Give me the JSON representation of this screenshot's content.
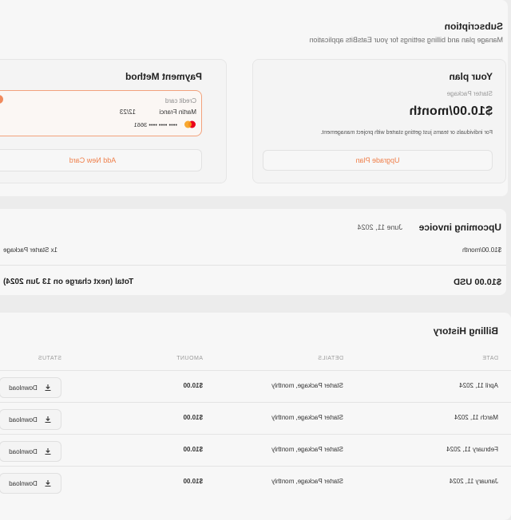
{
  "subscription": {
    "title": "Subscription",
    "subtitle": "Manage plan and billing settings for your EatsBits application"
  },
  "plan": {
    "title": "Your plan",
    "package_label": "Starter Package",
    "price": "$10.00/month",
    "description": "For individuals or teams just getting started with project management.",
    "upgrade_label": "Upgrade Plan"
  },
  "payment": {
    "title": "Payment Method",
    "card_type": "Credit card",
    "card_name": "Martin Franci",
    "card_expiry": "12/23",
    "card_number": "•••• •••• •••• 3661",
    "add_card_label": "Add New Card"
  },
  "invoice": {
    "title": "Upcoming invoice",
    "date": "June 11, 2024",
    "line_item": "1x Starter Package",
    "line_amount": "$10.00/month",
    "total_label": "Total (next charge on 13 Jun 2024)",
    "total_amount": "$10.00 USD"
  },
  "history": {
    "title": "Billing History",
    "columns": {
      "date": "DATE",
      "details": "DETAILS",
      "amount": "AMOUNT",
      "status": "STATUS"
    },
    "download_label": "Download",
    "rows": [
      {
        "date": "April 11, 2024",
        "details": "Starter Package, monthly",
        "amount": "$10.00"
      },
      {
        "date": "March 11, 2024",
        "details": "Starter Package, monthly",
        "amount": "$10.00"
      },
      {
        "date": "February 11, 2024",
        "details": "Starter Package, monthly",
        "amount": "$10.00"
      },
      {
        "date": "January 11, 2024",
        "details": "Starter Package, monthly",
        "amount": "$10.00"
      }
    ]
  },
  "colors": {
    "accent": "#ef7f4a",
    "background": "#ececec",
    "panel": "#f7f7f7"
  },
  "icons": {
    "radio": "radio-selected-icon",
    "card_brand": "mastercard-icon",
    "menu": "kebab-menu-icon",
    "download": "download-icon"
  }
}
